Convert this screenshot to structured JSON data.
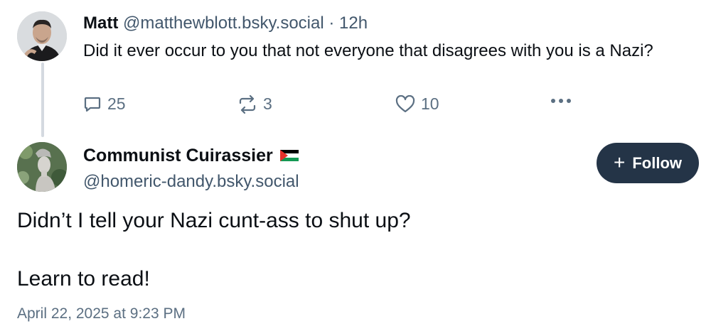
{
  "parent_post": {
    "author_name": "Matt",
    "author_handle": "@matthewblott.bsky.social",
    "separator": "·",
    "time_ago": "12h",
    "text": "Did it ever occur to you that not everyone that disagrees with you is a Nazi?",
    "actions": {
      "reply_count": "25",
      "repost_count": "3",
      "like_count": "10",
      "more_icon": "ellipsis-icon"
    }
  },
  "main_post": {
    "author_name": "Communist Cuirassier",
    "author_flag": "palestine-flag",
    "author_handle": "@homeric-dandy.bsky.social",
    "follow_button": {
      "icon": "+",
      "label": "Follow"
    },
    "text_paragraphs": [
      "Didn’t I tell your Nazi cunt-ass to shut up?",
      "Learn to read!"
    ],
    "timestamp": "April 22, 2025 at 9:23 PM"
  },
  "colors": {
    "follow_button_bg": "#243447",
    "muted_text": "#42576c",
    "icon_gray": "#5b6f82",
    "thread_line": "#d4d9e0"
  }
}
